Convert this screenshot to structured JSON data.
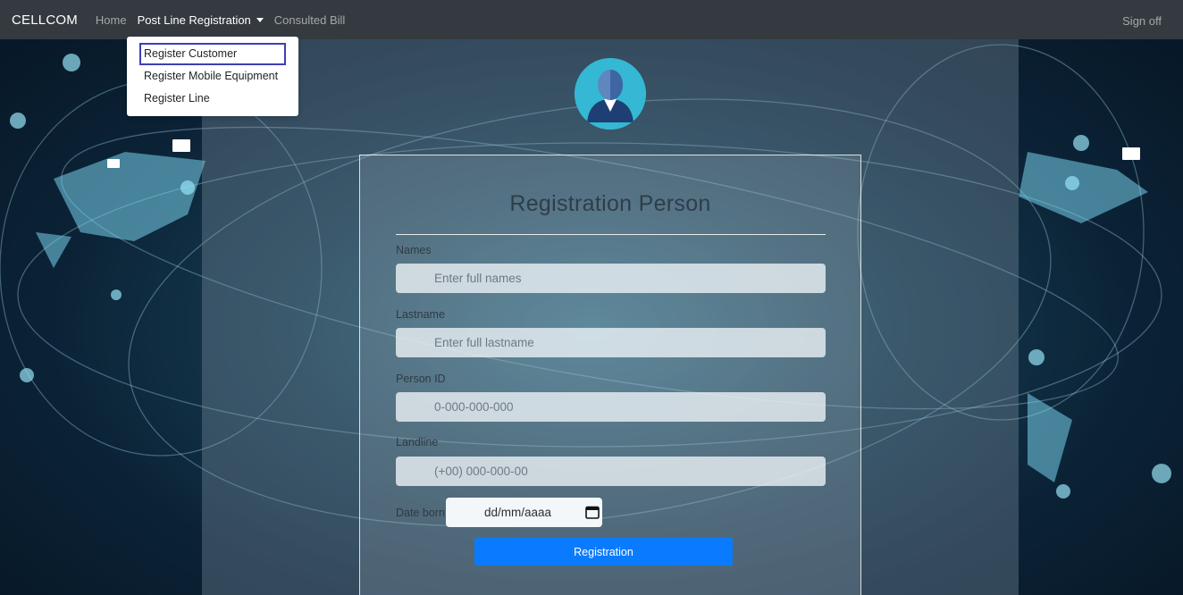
{
  "navbar": {
    "brand": "CELLCOM",
    "links": [
      "Home",
      "Post Line Registration",
      "Consulted Bill"
    ],
    "signoff": "Sign off"
  },
  "dropdown": {
    "items": [
      "Register Customer",
      "Register Mobile Equipment",
      "Register Line"
    ],
    "focused_index": 0
  },
  "form": {
    "title": "Registration Person",
    "fields": [
      {
        "label": "Names",
        "placeholder": "Enter full names"
      },
      {
        "label": "Lastname",
        "placeholder": "Enter full lastname"
      },
      {
        "label": "Person ID",
        "placeholder": "0-000-000-000"
      },
      {
        "label": "Landline",
        "placeholder": "(+00) 000-000-00"
      }
    ],
    "date_label": "Date born",
    "date_placeholder": "dd/mm/aaaa",
    "submit_label": "Registration"
  },
  "icons": {
    "avatar": "user-avatar-icon",
    "date": "calendar-icon",
    "caret": "chevron-down-icon"
  },
  "colors": {
    "navbar": "#343a40",
    "button": "#0a7bff",
    "avatar": "#35b8d3",
    "focus_outline": "#3c3fb6"
  }
}
